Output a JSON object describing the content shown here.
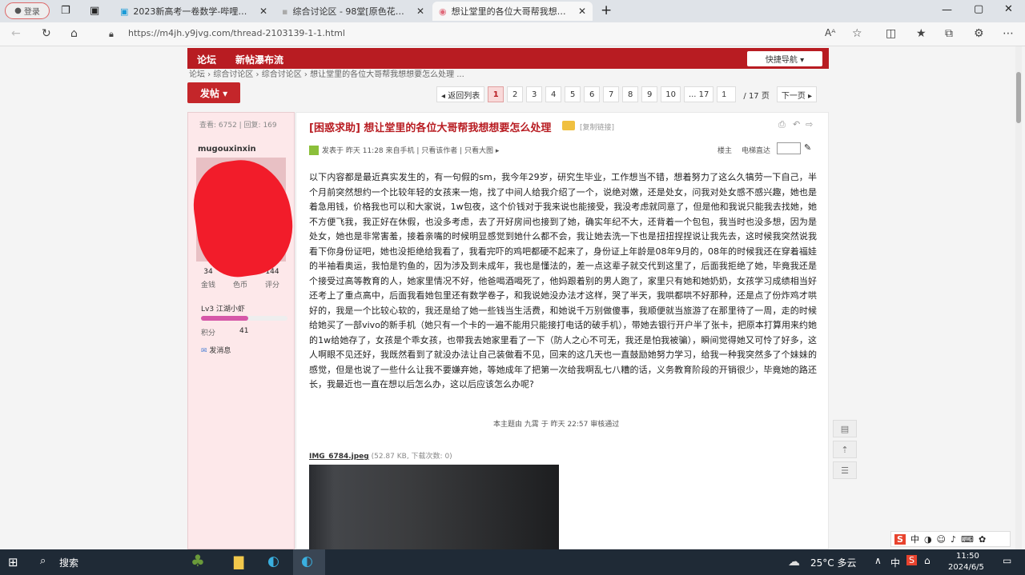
{
  "browser": {
    "login_label": "登录",
    "tabs": [
      {
        "title": "2023新高考一卷数学-哔哩哔哩_b",
        "active": false
      },
      {
        "title": "综合讨论区 - 98堂[原色花堂] - P",
        "active": false
      },
      {
        "title": "想让堂里的各位大哥帮我想想要",
        "active": true
      }
    ],
    "url": "https://m4jh.y9jvg.com/thread-2103139-1-1.html"
  },
  "site": {
    "nav": [
      "论坛",
      "新帖瀑布流"
    ],
    "quick_nav": "快捷导航 ▾",
    "breadcrumb": "论坛 › 综合讨论区 › 综合讨论区 › 想让堂里的各位大哥帮我想想要怎么处理 ...",
    "post_button": "发帖 ▾",
    "pager": {
      "back": "◂ 返回列表",
      "pages": [
        "1",
        "2",
        "3",
        "4",
        "5",
        "6",
        "7",
        "8",
        "9",
        "10"
      ],
      "current": "1",
      "last": "... 17",
      "input_value": "1",
      "total": "/ 17 页",
      "next": "下一页 ▸"
    }
  },
  "author": {
    "views_label": "查看: 6752 | 回复: 169",
    "username": "mugouxinxin",
    "stats": [
      {
        "value": "34",
        "label": "金钱"
      },
      {
        "value": "0",
        "label": "色币"
      },
      {
        "value": "144",
        "label": "评分"
      }
    ],
    "level": "Lv3 江湖小虾",
    "level_progress": 0.55,
    "points_label": "积分",
    "points": "41",
    "message": "发消息"
  },
  "post": {
    "title": "[困惑求助] 想让堂里的各位大哥帮我想想要怎么处理",
    "copy_link": "[复制链接]",
    "meta": "发表于 昨天 11:28 来自手机 | 只看该作者 | 只看大图 ▸",
    "floor": "楼主",
    "jump_label": "电梯直达",
    "body": "以下内容都是最近真实发生的，有一句假的sm，我今年29岁，研究生毕业，工作想当不错，想着努力了这么久犒劳一下自己，半个月前突然想约一个比较年轻的女孩来一炮，找了中间人给我介绍了一个，说绝对嫩，还是处女，问我对处女感不感兴趣，她也是着急用钱，价格我也可以和大家说，1w包夜，这个价钱对于我来说也能接受，我没考虑就同意了，但是他和我说只能我去找她，她不方便飞我，我正好在休假，也没多考虑，去了开好房间也接到了她，确实年纪不大，还背着一个包包，我当时也没多想，因为是处女，她也是非常害羞，接着亲嘴的时候明显感觉到她什么都不会，我让她去洗一下也是扭扭捏捏说让我先去，这时候我突然说我看下你身份证吧，她也没拒绝给我看了，我看完吓的鸡吧都硬不起来了，身份证上年龄是08年9月的，08年的时候我还在穿着福娃的半袖看奥运，我怕是钓鱼的，因为涉及到未成年，我也是懂法的，差一点这辈子就交代到这里了，后面我拒绝了她，毕竟我还是个接受过高等教育的人，她家里情况不好，他爸喝酒喝死了，他妈跟着别的男人跑了，家里只有她和她奶奶，女孩学习成绩相当好还考上了重点高中，后面我看她包里还有数学卷子，和我说她没办法才这样，哭了半天，我哄都哄不好那种，还是点了份炸鸡才哄好的，我是一个比较心软的，我还是给了她一些钱当生活费，和她说千万别做傻事，我顺便就当旅游了在那里待了一周，走的时候给她买了一部vivo的新手机（她只有一个卡的一遍不能用只能接打电话的破手机），带她去银行开户半了张卡，把原本打算用来约她的1w给她存了，女孩是个乖女孩，也带我去她家里看了一下（防人之心不可无，我还是怕我被骗），瞬间觉得她又可怜了好多，这人啊眼不见还好，我既然看到了就没办法让自己装做看不见，回来的这几天也一直鼓励她努力学习，给我一种我突然多了个妹妹的感觉，但是也说了一些什么让我不要嫌弃她，等她成年了把第一次给我啊乱七八糟的话，义务教育阶段的开销很少，毕竟她的路还长，我最近也一直在想以后怎么办，这以后应该怎么办呢?",
    "approval": "本主题由 九霄 于 昨天 22:57 审核通过",
    "attachment_name": "IMG_6784.jpeg",
    "attachment_info": "(52.87 KB, 下载次数: 0)"
  },
  "taskbar": {
    "search": "搜索",
    "weather": "25°C 多云",
    "time": "11:50",
    "date": "2024/6/5",
    "ime": "中",
    "ime2": "中"
  }
}
